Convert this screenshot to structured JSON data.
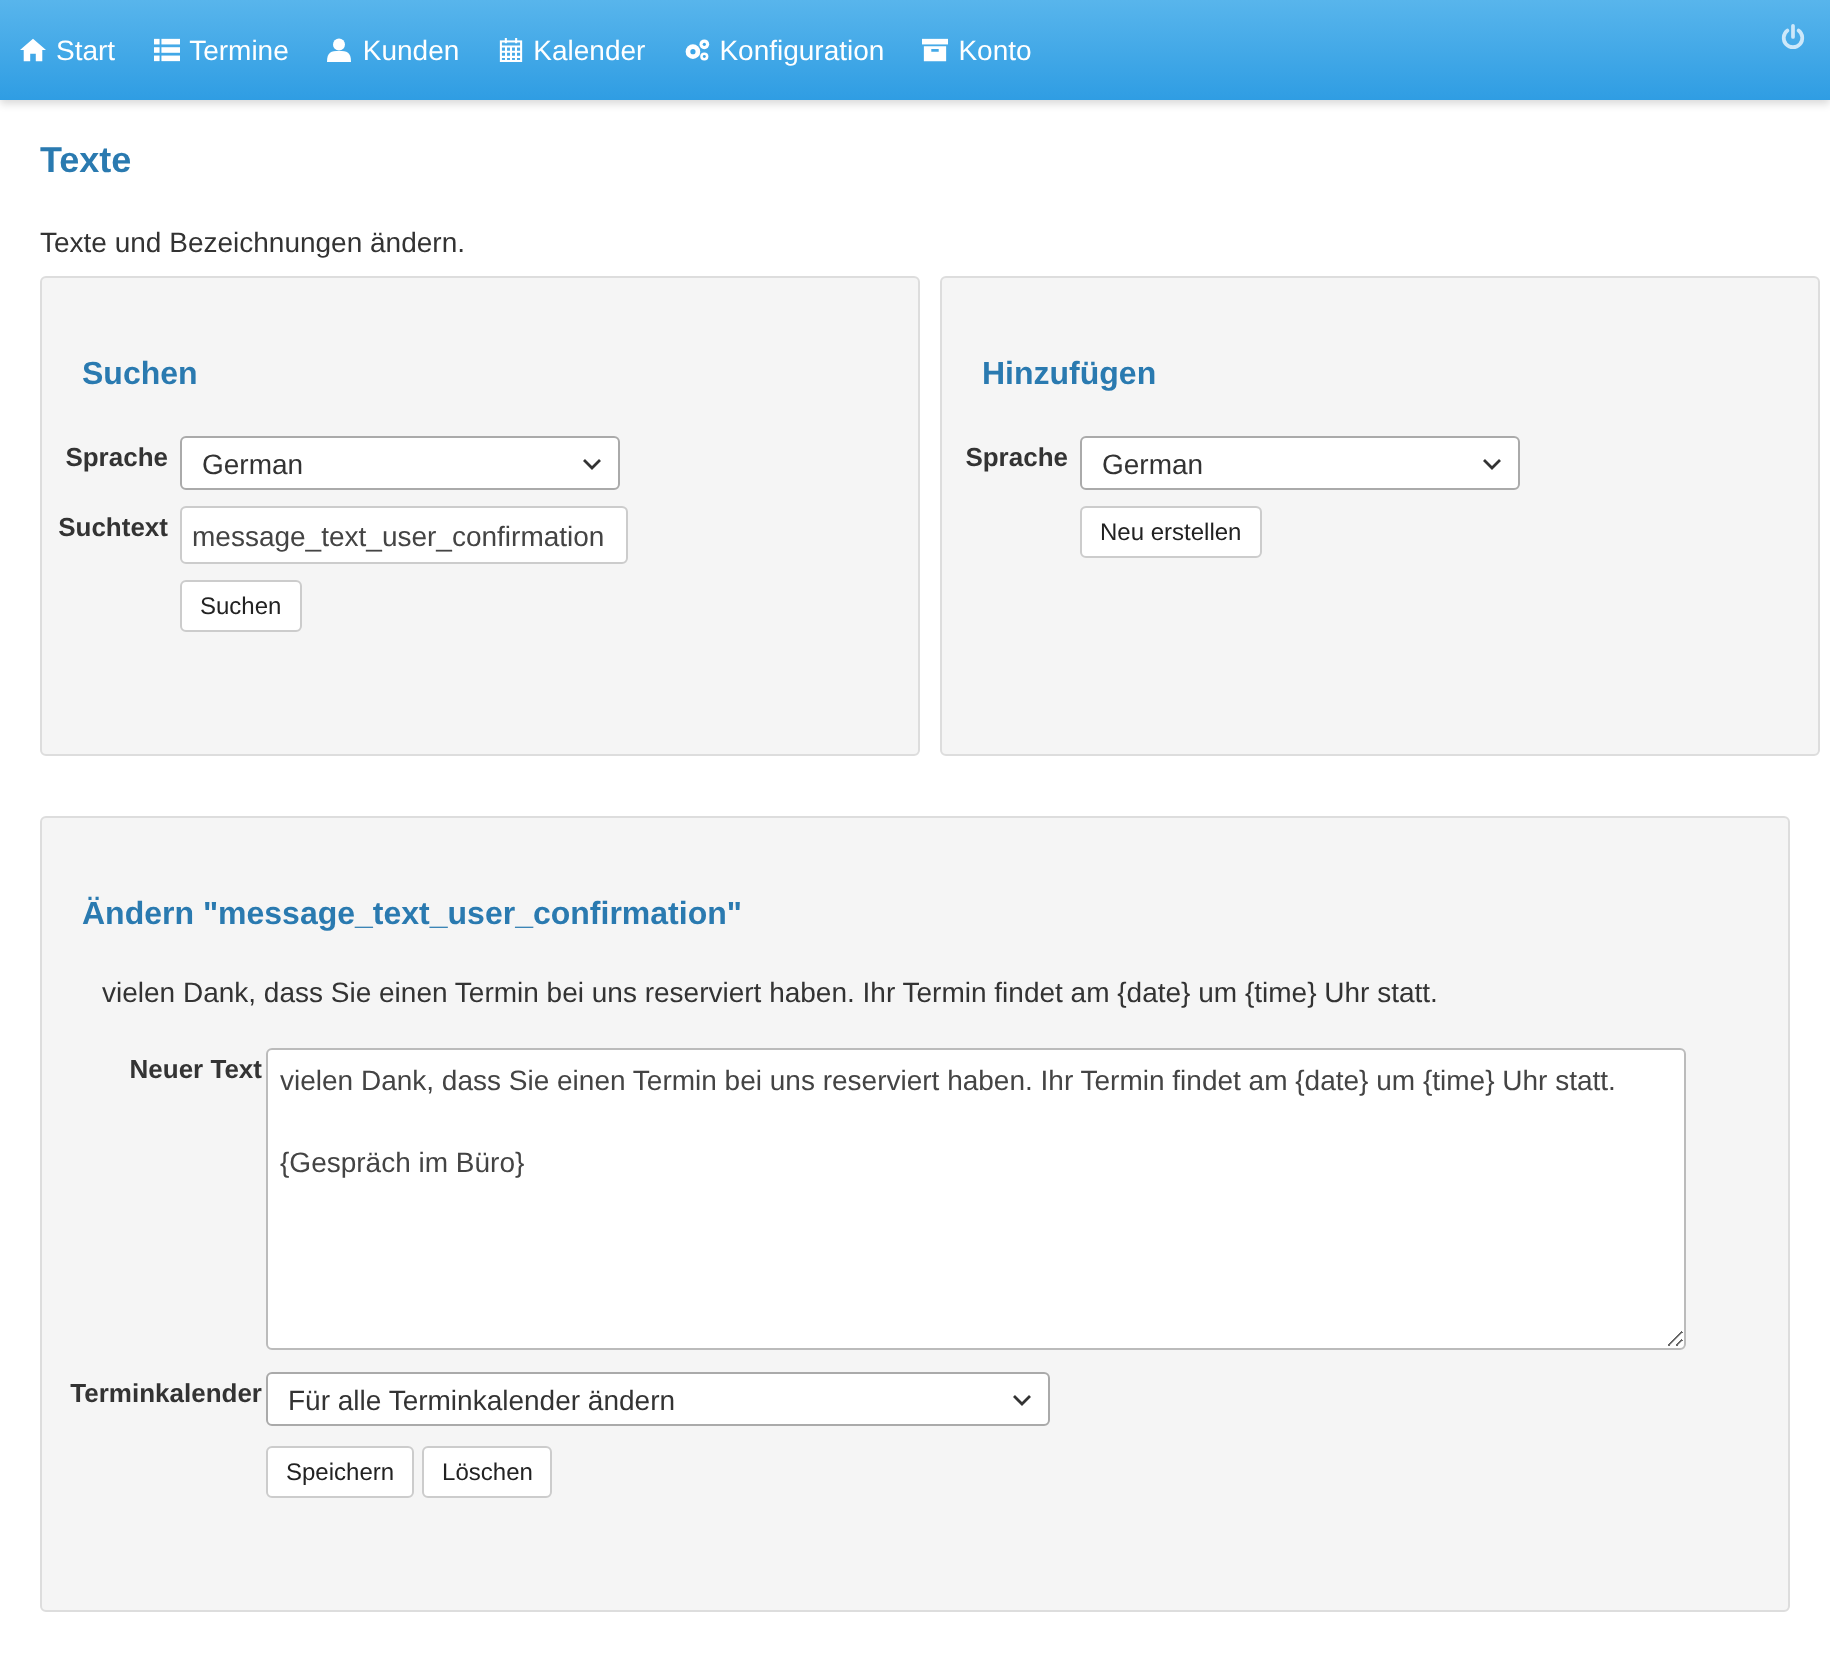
{
  "nav": {
    "items": [
      {
        "label": "Start",
        "kind": "home"
      },
      {
        "label": "Termine",
        "kind": "list"
      },
      {
        "label": "Kunden",
        "kind": "user"
      },
      {
        "label": "Kalender",
        "kind": "calendar"
      },
      {
        "label": "Konfiguration",
        "kind": "gears"
      },
      {
        "label": "Konto",
        "kind": "archive"
      }
    ]
  },
  "title": "Texte",
  "subtitle": "Texte und Bezeichnungen ändern.",
  "search": {
    "heading": "Suchen",
    "language_label": "Sprache",
    "language": "German",
    "text_label": "Suchtext",
    "text": "message_text_user_confirmation",
    "button": "Suchen"
  },
  "add": {
    "heading": "Hinzufügen",
    "language_label": "Sprache",
    "language": "German",
    "button": "Neu erstellen"
  },
  "edit": {
    "heading": "Ändern \"message_text_user_confirmation\"",
    "current_text": "vielen Dank, dass Sie einen Termin bei uns reserviert haben. Ihr Termin findet am {date} um {time} Uhr statt.",
    "new_text_label": "Neuer Text",
    "new_text": "vielen Dank, dass Sie einen Termin bei uns reserviert haben. Ihr Termin findet am {date} um {time} Uhr statt.\n\n{Gespräch im Büro}",
    "calendar_label": "Terminkalender",
    "calendar": "Für alle Terminkalender ändern",
    "buttons": [
      "Speichern",
      "Löschen"
    ]
  }
}
